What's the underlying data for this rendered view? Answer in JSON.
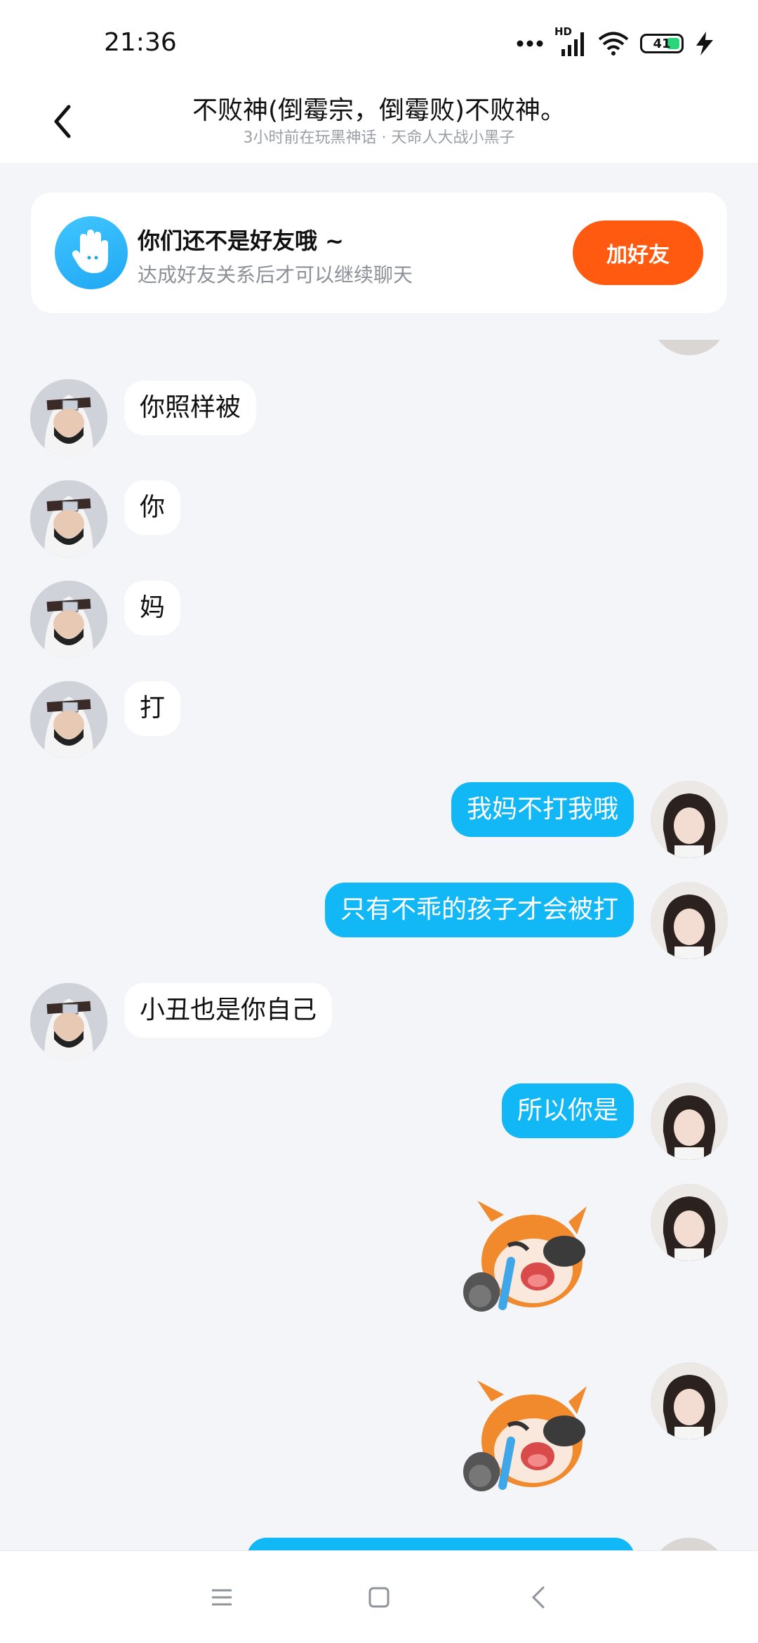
{
  "status_bar": {
    "time": "21:36",
    "network": "HD",
    "battery": "41"
  },
  "header": {
    "title": "不败神(倒霉宗，倒霉败)不败神。",
    "subtitle": "3小时前在玩黑神话 · 天命人大战小黑子"
  },
  "friend_notice": {
    "title": "你们还不是好友哦 ~",
    "description": "达成好友关系后才可以继续聊天",
    "button_label": "加好友"
  },
  "messages": [
    {
      "sender": "other",
      "text": "你照样被"
    },
    {
      "sender": "other",
      "text": "你"
    },
    {
      "sender": "other",
      "text": "妈"
    },
    {
      "sender": "other",
      "text": "打"
    },
    {
      "sender": "me",
      "text": "我妈不打我哦"
    },
    {
      "sender": "me",
      "text": "只有不乖的孩子才会被打"
    },
    {
      "sender": "other",
      "text": "小丑也是你自己"
    },
    {
      "sender": "me",
      "text": "所以你是"
    },
    {
      "sender": "me",
      "type": "sticker",
      "sticker": "crying-laughing-sticker"
    },
    {
      "sender": "me",
      "type": "sticker",
      "sticker": "crying-laughing-sticker"
    }
  ],
  "colors": {
    "accent_bubble": "#12b7f5",
    "add_friend_button": "#ff5a10",
    "background": "#f3f5f8"
  },
  "nav_icons": [
    "menu-icon",
    "home-icon",
    "back-nav-icon"
  ]
}
